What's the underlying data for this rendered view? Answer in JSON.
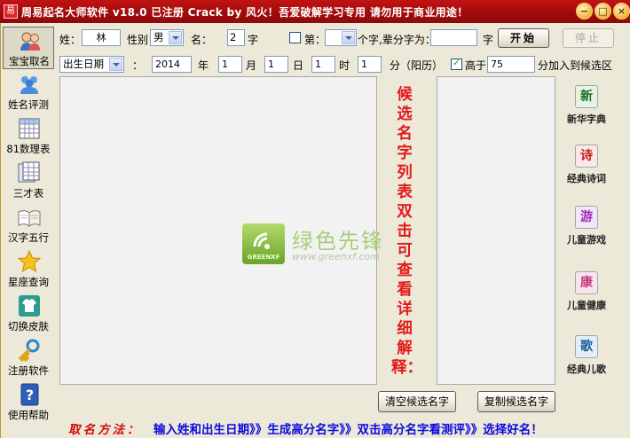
{
  "window": {
    "title": "周易起名大师软件 v18.0  已注册  Crack by 风火！吾爱破解学习专用 请勿用于商业用途！",
    "app_icon": "易",
    "min_glyph": "−",
    "max_glyph": "□",
    "close_glyph": "×"
  },
  "sidebar": {
    "items": [
      {
        "label": "宝宝取名",
        "icon": "baby-avatar-icon"
      },
      {
        "label": "姓名评测",
        "icon": "users-icon"
      },
      {
        "label": "81数理表",
        "icon": "calculator-icon"
      },
      {
        "label": "三才表",
        "icon": "table-icon"
      },
      {
        "label": "汉字五行",
        "icon": "open-book-icon"
      },
      {
        "label": "星座查询",
        "icon": "star-icon"
      },
      {
        "label": "切换皮肤",
        "icon": "shirt-icon"
      },
      {
        "label": "注册软件",
        "icon": "key-icon"
      },
      {
        "label": "使用帮助",
        "icon": "help-icon"
      }
    ]
  },
  "form": {
    "surname_label": "姓：",
    "surname_value": "林",
    "gender_label": "性别",
    "gender_value": "男",
    "name_label": "名：",
    "name_count": "2",
    "name_unit": "字",
    "position_label": "第：",
    "position_value": "",
    "generation_label": "个字,辈分字为：",
    "generation_value": "",
    "generation_unit": "字",
    "start_button": "开始",
    "stop_button": "停止",
    "date_type": "出生日期",
    "colon": "：",
    "year": "2014",
    "year_unit": "年",
    "month": "1",
    "month_unit": "月",
    "day": "1",
    "day_unit": "日",
    "hour": "1",
    "hour_unit": "时",
    "minute": "1",
    "minute_unit": "分（阳历）",
    "above_label": "高于",
    "score_threshold": "75",
    "score_suffix": "分加入到候选区"
  },
  "hint_text": "候选名字列表双击可查看详细解释：",
  "watermark": {
    "logo_text": "GREENXF",
    "name": "绿色先锋",
    "url": "www.greenxf.com"
  },
  "tools": [
    {
      "label": "新华字典",
      "glyph": "新",
      "color": "#1f6d2a"
    },
    {
      "label": "经典诗词",
      "glyph": "诗",
      "color": "#c21a1a"
    },
    {
      "label": "儿童游戏",
      "glyph": "游",
      "color": "#9d2bb4"
    },
    {
      "label": "儿童健康",
      "glyph": "康",
      "color": "#c43a7b"
    },
    {
      "label": "经典儿歌",
      "glyph": "歌",
      "color": "#1b5f9c"
    }
  ],
  "buttons": {
    "clear_candidates": "清空候选名字",
    "copy_candidates": "复制候选名字"
  },
  "bottom": {
    "method_label": "取名方法：",
    "steps": "输入姓和出生日期》》生成高分名字》》双击高分名字看测评》》选择好名！"
  }
}
